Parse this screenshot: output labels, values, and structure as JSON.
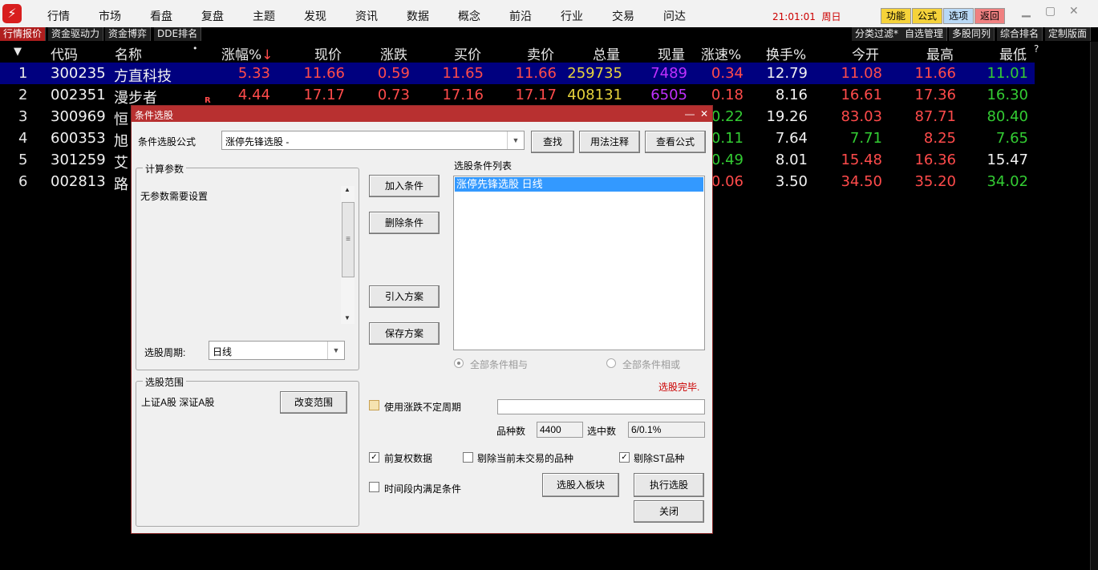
{
  "app": {
    "logo_glyph": "⚡",
    "menu": [
      "行情",
      "市场",
      "看盘",
      "复盘",
      "主题",
      "发现",
      "资讯",
      "数据",
      "概念",
      "前沿",
      "行业",
      "交易",
      "问达"
    ],
    "clock": "21:01:01",
    "weekday": "周日",
    "quick_buttons": [
      "功能",
      "公式",
      "选项",
      "返回"
    ]
  },
  "tabs_left": [
    "行情报价",
    "资金驱动力",
    "资金博弈",
    "DDE排名"
  ],
  "tabs_right": [
    "分类过滤*",
    "自选管理",
    "多股同列",
    "综合排名",
    "定制版面"
  ],
  "table": {
    "sort_marker": "▼",
    "sort_arrow": "↓",
    "name_dot": "•",
    "help_mark": "?",
    "headers": [
      "代码",
      "名称",
      "涨幅%",
      "现价",
      "涨跌",
      "买价",
      "卖价",
      "总量",
      "现量",
      "涨速%",
      "换手%",
      "今开",
      "最高",
      "最低"
    ],
    "rows": [
      {
        "idx": "1",
        "code": "300235",
        "name": "方直科技",
        "flag": "",
        "chg": "5.33",
        "price": "11.66",
        "diff": "0.59",
        "bid": "11.65",
        "ask": "11.66",
        "vol": "259735",
        "cur": "7489",
        "speed": "0.34",
        "turn": "12.79",
        "open": "11.08",
        "high": "11.66",
        "low": "11.01"
      },
      {
        "idx": "2",
        "code": "002351",
        "name": "漫步者",
        "flag": "R",
        "chg": "4.44",
        "price": "17.17",
        "diff": "0.73",
        "bid": "17.16",
        "ask": "17.17",
        "vol": "408131",
        "cur": "6505",
        "speed": "0.18",
        "turn": "8.16",
        "open": "16.61",
        "high": "17.36",
        "low": "16.30"
      },
      {
        "idx": "3",
        "code": "300969",
        "name": "恒",
        "flag": "",
        "speed": "0.22",
        "turn": "19.26",
        "open": "83.03",
        "high": "87.71",
        "low": "80.40"
      },
      {
        "idx": "4",
        "code": "600353",
        "name": "旭",
        "flag": "",
        "speed": "0.11",
        "turn": "7.64",
        "open": "7.71",
        "high": "8.25",
        "low": "7.65"
      },
      {
        "idx": "5",
        "code": "301259",
        "name": "艾",
        "flag": "",
        "speed": "0.49",
        "turn": "8.01",
        "open": "15.48",
        "high": "16.36",
        "low": "15.47"
      },
      {
        "idx": "6",
        "code": "002813",
        "name": "路",
        "flag": "",
        "speed": "0.06",
        "turn": "3.50",
        "open": "34.50",
        "high": "35.20",
        "low": "34.02"
      }
    ]
  },
  "dialog": {
    "title": "条件选股",
    "minimize": "—",
    "close": "✕",
    "formula_label": "条件选股公式",
    "formula_value": "涨停先锋选股 -",
    "btn_find": "查找",
    "btn_usage": "用法注释",
    "btn_view": "查看公式",
    "params_title": "计算参数",
    "params_text": "无参数需要设置",
    "period_label": "选股周期:",
    "period_value": "日线",
    "btn_add": "加入条件",
    "btn_delete": "删除条件",
    "btn_import": "引入方案",
    "btn_save": "保存方案",
    "list_title": "选股条件列表",
    "list_items": [
      "涨停先锋选股  日线"
    ],
    "radio_and": "全部条件相与",
    "radio_or": "全部条件相或",
    "status": "选股完毕.",
    "range_title": "选股范围",
    "range_text": "上证A股 深证A股",
    "btn_change_range": "改变范围",
    "chk_variable_period": "使用涨跌不定周期",
    "count_label": "品种数",
    "count_value": "4400",
    "selected_label": "选中数",
    "selected_value": "6/0.1%",
    "chk_forward": "前复权数据",
    "chk_exclude_untraded": "剔除当前未交易的品种",
    "chk_exclude_st": "剔除ST品种",
    "chk_time_range": "时间段内满足条件",
    "btn_to_block": "选股入板块",
    "btn_execute": "执行选股",
    "btn_close": "关闭",
    "checked_mark": "✓"
  },
  "colors": {
    "up": "#ff4b4b",
    "down": "#33cc33",
    "selected_row": "#00007f",
    "title_bar": "#b83030"
  }
}
